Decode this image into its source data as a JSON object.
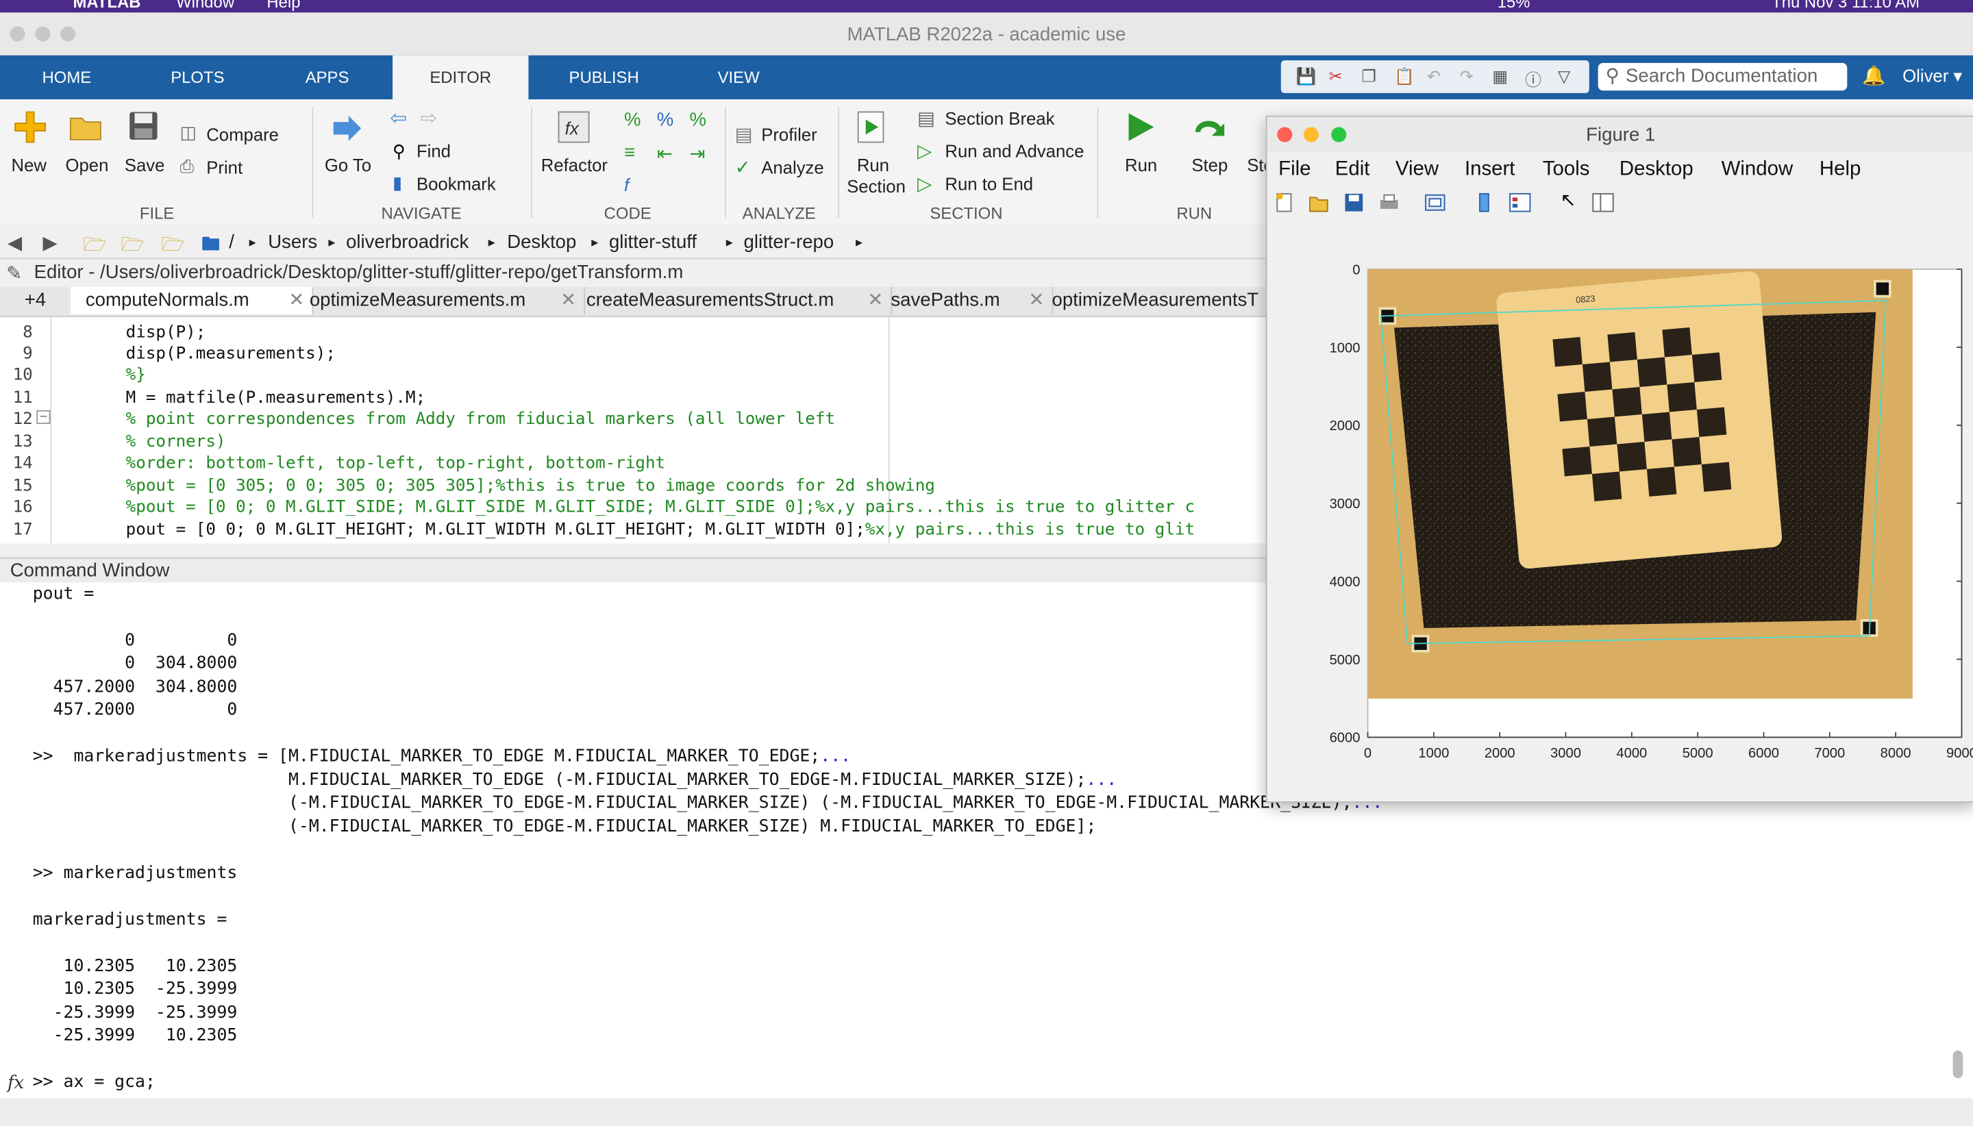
{
  "menubar": {
    "app": "MATLAB",
    "items": [
      "Window",
      "Help"
    ],
    "battery": "15%",
    "clock": "Thu Nov 3  11:10 AM"
  },
  "window": {
    "title": "MATLAB R2022a - academic use"
  },
  "ribbon_tabs": [
    "HOME",
    "PLOTS",
    "APPS",
    "EDITOR",
    "PUBLISH",
    "VIEW"
  ],
  "search": {
    "placeholder": "Search Documentation"
  },
  "user": {
    "name": "Oliver"
  },
  "ribbon": {
    "file": {
      "new": "New",
      "open": "Open",
      "save": "Save",
      "compare": "Compare",
      "print": "Print",
      "group": "FILE"
    },
    "navigate": {
      "goto_1": "Go To",
      "find": "Find",
      "bookmark": "Bookmark",
      "group": "NAVIGATE"
    },
    "code": {
      "refactor": "Refactor",
      "group": "CODE"
    },
    "analyze": {
      "profiler": "Profiler",
      "analyze": "Analyze",
      "group": "ANALYZE"
    },
    "section": {
      "run_section_1": "Run",
      "run_section_2": "Section",
      "section_break": "Section Break",
      "run_and_advance": "Run and Advance",
      "run_to_end": "Run to End",
      "group": "SECTION"
    },
    "run": {
      "run": "Run",
      "step": "Step",
      "stop": "Sto",
      "group": "RUN"
    }
  },
  "address": {
    "root": "/",
    "crumbs": [
      "Users",
      "oliverbroadrick",
      "Desktop",
      "glitter-stuff",
      "glitter-repo"
    ]
  },
  "editor": {
    "title": "Editor - /Users/oliverbroadrick/Desktop/glitter-stuff/glitter-repo/getTransform.m",
    "more_tabs": "+4",
    "tabs": [
      "computeNormals.m",
      "optimizeMeasurements.m",
      "createMeasurementsStruct.m",
      "savePaths.m",
      "optimizeMeasurementsT"
    ],
    "lines": [
      {
        "n": "8",
        "text": "disp(P);"
      },
      {
        "n": "9",
        "text": "disp(P.measurements);"
      },
      {
        "n": "10",
        "text": "%}"
      },
      {
        "n": "11",
        "text": "M = matfile(P.measurements).M;"
      },
      {
        "n": "12",
        "text": "% point correspondences from Addy from fiducial markers (all lower left"
      },
      {
        "n": "13",
        "text": "% corners)"
      },
      {
        "n": "14",
        "text": "%order: bottom-left, top-left, top-right, bottom-right"
      },
      {
        "n": "15",
        "text": "%pout = [0 305; 0 0; 305 0; 305 305];%this is true to image coords for 2d showing"
      },
      {
        "n": "16",
        "text": "%pout = [0 0; 0 M.GLIT_SIDE; M.GLIT_SIDE M.GLIT_SIDE; M.GLIT_SIDE 0];%x,y pairs...this is true to glitter c"
      },
      {
        "n": "17",
        "code": "pout = [0 0; 0 M.GLIT_HEIGHT; M.GLIT_WIDTH M.GLIT_HEIGHT; M.GLIT_WIDTH 0];",
        "comment": "%x,y pairs...this is true to glit"
      }
    ]
  },
  "command_window": {
    "title": "Command Window",
    "lines": [
      "pout =",
      "",
      "         0         0",
      "         0  304.8000",
      "  457.2000  304.8000",
      "  457.2000         0",
      "",
      ">>  markeradjustments = [M.FIDUCIAL_MARKER_TO_EDGE M.FIDUCIAL_MARKER_TO_EDGE;",
      "                         M.FIDUCIAL_MARKER_TO_EDGE (-M.FIDUCIAL_MARKER_TO_EDGE-M.FIDUCIAL_MARKER_SIZE);",
      "                         (-M.FIDUCIAL_MARKER_TO_EDGE-M.FIDUCIAL_MARKER_SIZE) (-M.FIDUCIAL_MARKER_TO_EDGE-M.FIDUCIAL_MARKER_SIZE);",
      "                         (-M.FIDUCIAL_MARKER_TO_EDGE-M.FIDUCIAL_MARKER_SIZE) M.FIDUCIAL_MARKER_TO_EDGE];",
      "",
      ">> markeradjustments",
      "",
      "markeradjustments =",
      "",
      "   10.2305   10.2305",
      "   10.2305  -25.3999",
      "  -25.3999  -25.3999",
      "  -25.3999   10.2305",
      "",
      ">> ax = gca;"
    ],
    "continuation": "...",
    "fx": "fx"
  },
  "figure": {
    "title": "Figure 1",
    "menu": [
      "File",
      "Edit",
      "View",
      "Insert",
      "Tools",
      "Desktop",
      "Window",
      "Help"
    ],
    "image_label": "0823",
    "axes": {
      "xticks": [
        "0",
        "1000",
        "2000",
        "3000",
        "4000",
        "5000",
        "6000",
        "7000",
        "8000",
        "9000"
      ],
      "yticks": [
        "0",
        "1000",
        "2000",
        "3000",
        "4000",
        "5000",
        "6000"
      ],
      "xlim": [
        0,
        9000
      ],
      "ylim": [
        0,
        6000
      ],
      "image_extent": [
        0,
        8256,
        0,
        5504
      ],
      "quad": [
        [
          200,
          600
        ],
        [
          7850,
          400
        ],
        [
          7600,
          4700
        ],
        [
          600,
          4800
        ]
      ]
    }
  },
  "colors": {
    "ribbon_blue": "#1d5fa3",
    "comment_green": "#1f8a1f",
    "quad_line": "#4fd7c8",
    "plum_menubar": "#4b2a8a"
  }
}
